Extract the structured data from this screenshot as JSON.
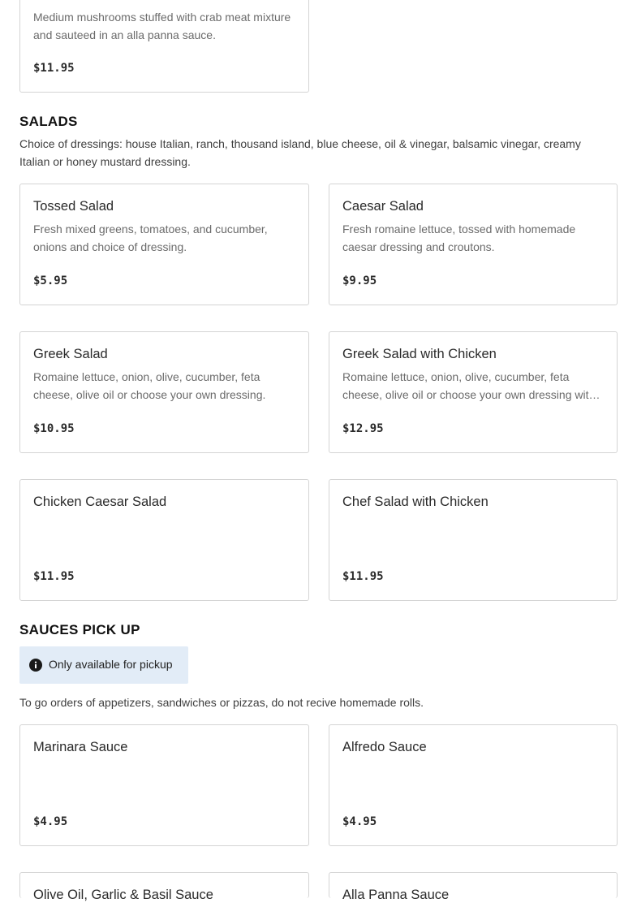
{
  "partial_item": {
    "description": "Medium mushrooms stuffed with crab meat mixture and sauteed in an alla panna sauce.",
    "price": "$11.95"
  },
  "salads": {
    "title": "SALADS",
    "description": "Choice of dressings: house Italian, ranch, thousand island, blue cheese, oil & vinegar, balsamic vinegar, creamy Italian or honey mustard dressing.",
    "items": [
      {
        "name": "Tossed Salad",
        "description": "Fresh mixed greens, tomatoes, and cucumber, onions and choice of dressing.",
        "price": "$5.95"
      },
      {
        "name": "Caesar Salad",
        "description": "Fresh romaine lettuce, tossed with homemade caesar dressing and croutons.",
        "price": "$9.95"
      },
      {
        "name": "Greek Salad",
        "description": "Romaine lettuce, onion, olive, cucumber, feta cheese, olive oil or choose your own dressing.",
        "price": "$10.95"
      },
      {
        "name": "Greek Salad with Chicken",
        "description": "Romaine lettuce, onion, olive, cucumber, feta cheese, olive oil or choose your own dressing wit…",
        "price": "$12.95"
      },
      {
        "name": "Chicken Caesar Salad",
        "description": "",
        "price": "$11.95"
      },
      {
        "name": "Chef Salad with Chicken",
        "description": "",
        "price": "$11.95"
      }
    ]
  },
  "sauces": {
    "title": "SAUCES PICK UP",
    "badge": {
      "icon": "info-icon",
      "text": "Only available for pickup",
      "color": "#e2ecf7"
    },
    "description": "To go orders of appetizers, sandwiches or pizzas, do not recive homemade rolls.",
    "items": [
      {
        "name": "Marinara Sauce",
        "description": "",
        "price": "$4.95"
      },
      {
        "name": "Alfredo Sauce",
        "description": "",
        "price": "$4.95"
      },
      {
        "name": "Olive Oil, Garlic & Basil Sauce",
        "description": "",
        "price": ""
      },
      {
        "name": "Alla Panna Sauce",
        "description": "",
        "price": ""
      }
    ]
  }
}
